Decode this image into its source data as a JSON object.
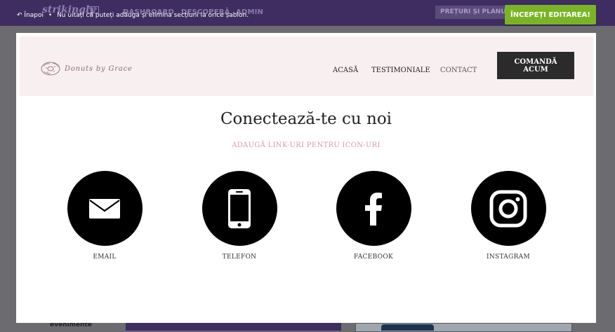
{
  "editor": {
    "logo": "strikingly",
    "vip": "VIP",
    "nav": [
      "DASHBOARD",
      "DESCOPERĂ",
      "ADMIN"
    ],
    "pricing": "PREȚURI ȘI PLANURI",
    "back_label": "Înapoi",
    "separator": "•",
    "hint": "Nu uitați că puteți adăuga și elimina secțiuni la orice șablon.",
    "start_button": "ÎNCEPEȚI EDITAREA!",
    "bg_text": "evenimente"
  },
  "site": {
    "brand_name": "Donuts by Grace",
    "nav": [
      "ACASĂ",
      "TESTIMONIALE",
      "CONTACT"
    ],
    "order_button": "COMANDĂ ACUM"
  },
  "section": {
    "title": "Conectează-te cu noi",
    "subtitle": "ADAUGĂ LINK-URI PENTRU ICON-URI",
    "items": [
      {
        "label": "EMAIL",
        "icon": "envelope-icon"
      },
      {
        "label": "TELEFON",
        "icon": "phone-icon"
      },
      {
        "label": "FACEBOOK",
        "icon": "facebook-icon"
      },
      {
        "label": "INSTAGRAM",
        "icon": "instagram-icon"
      }
    ]
  },
  "colors": {
    "editor_bar": "#3f2d62",
    "accent_green": "#7ab426",
    "header_bg": "#f8f0f0",
    "subtitle_pink": "#d89aa8"
  }
}
